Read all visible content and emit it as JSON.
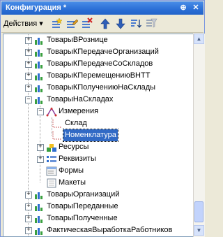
{
  "window": {
    "title": "Конфигурация *"
  },
  "titlebar_buttons": [
    {
      "icon": "pin-icon",
      "glyph": "⊕"
    },
    {
      "icon": "close-icon",
      "glyph": "✕"
    }
  ],
  "toolbar": {
    "actions_label": "Действия",
    "actions_arrow": "▾",
    "tools": [
      {
        "name": "add-tool",
        "icon": "add-icon"
      },
      {
        "name": "edit-tool",
        "icon": "edit-icon"
      },
      {
        "name": "delete-tool",
        "icon": "delete-icon"
      },
      {
        "name": "move-up-tool",
        "icon": "arrow-up-icon"
      },
      {
        "name": "move-down-tool",
        "icon": "arrow-down-icon"
      },
      {
        "name": "sort-tool",
        "icon": "sort-icon"
      },
      {
        "name": "filter-tool",
        "icon": "filter-icon"
      }
    ]
  },
  "tree": {
    "items": [
      {
        "label": "ТоварыВРознице",
        "expander": "+",
        "icon": "register-icon"
      },
      {
        "label": "ТоварыКПередачеОрганизаций",
        "expander": "+",
        "icon": "register-icon"
      },
      {
        "label": "ТоварыКПередачеСоСкладов",
        "expander": "+",
        "icon": "register-icon"
      },
      {
        "label": "ТоварыКПеремещениюВНТТ",
        "expander": "+",
        "icon": "register-icon"
      },
      {
        "label": "ТоварыКПолучениюНаСклады",
        "expander": "+",
        "icon": "register-icon"
      },
      {
        "label": "ТоварыНаСкладах",
        "expander": "−",
        "icon": "register-icon"
      },
      {
        "label": "Измерения",
        "expander": "−",
        "icon": "dimensions-icon"
      },
      {
        "label": "Склад",
        "expander": "",
        "icon": "dimension-icon"
      },
      {
        "label": "Номенклатура",
        "expander": "",
        "icon": "dimension-icon",
        "selected": true
      },
      {
        "label": "Ресурсы",
        "expander": "+",
        "icon": "resources-icon"
      },
      {
        "label": "Реквизиты",
        "expander": "+",
        "icon": "attributes-icon"
      },
      {
        "label": "Формы",
        "expander": "",
        "icon": "forms-icon"
      },
      {
        "label": "Макеты",
        "expander": "",
        "icon": "templates-icon"
      },
      {
        "label": "ТоварыОрганизаций",
        "expander": "+",
        "icon": "register-icon"
      },
      {
        "label": "ТоварыПереданные",
        "expander": "+",
        "icon": "register-icon"
      },
      {
        "label": "ТоварыПолученные",
        "expander": "+",
        "icon": "register-icon"
      },
      {
        "label": "ФактическаяВыработкаРаботников",
        "expander": "+",
        "icon": "register-icon"
      }
    ]
  },
  "scrollbar": {
    "up_glyph": "▲",
    "down_glyph": "▼"
  }
}
